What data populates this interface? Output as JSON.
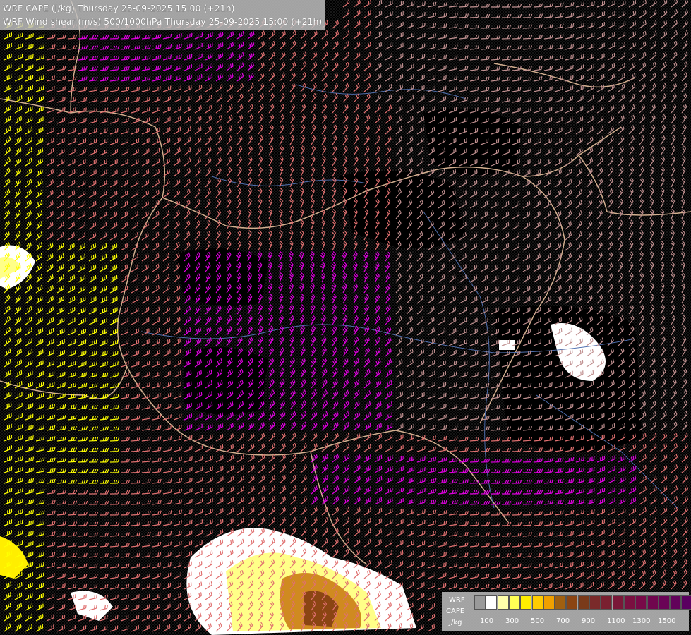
{
  "titles": {
    "line1": "WRF CAPE (J/kg) Thursday 25-09-2025 15:00 (+21h)",
    "line2": "WRF Wind shear (m/s) 500/1000hPa Thursday 25-09-2025 15:00 (+21h)"
  },
  "legend": {
    "name1": "WRF",
    "name2": "CAPE",
    "unit": "J/kg",
    "ticks": [
      "100",
      "300",
      "500",
      "700",
      "900",
      "1100",
      "1300",
      "1500"
    ],
    "colors": [
      "#9a9a9a",
      "#ffffff",
      "#ffffaa",
      "#ffff55",
      "#ffee00",
      "#ffcc00",
      "#f0a000",
      "#a06010",
      "#8b4513",
      "#7a3a1a",
      "#7a2a2a",
      "#7a2030",
      "#7a1838",
      "#7a1040",
      "#780a48",
      "#70064e",
      "#6a0456",
      "#62025a",
      "#5a0060"
    ]
  },
  "colors": {
    "shear_low": "#ffff00",
    "shear_mid": "#e07070",
    "shear_high": "#e000e0",
    "shear_weak": "#c09090",
    "border": "#d4b090",
    "river": "#5070b0"
  }
}
